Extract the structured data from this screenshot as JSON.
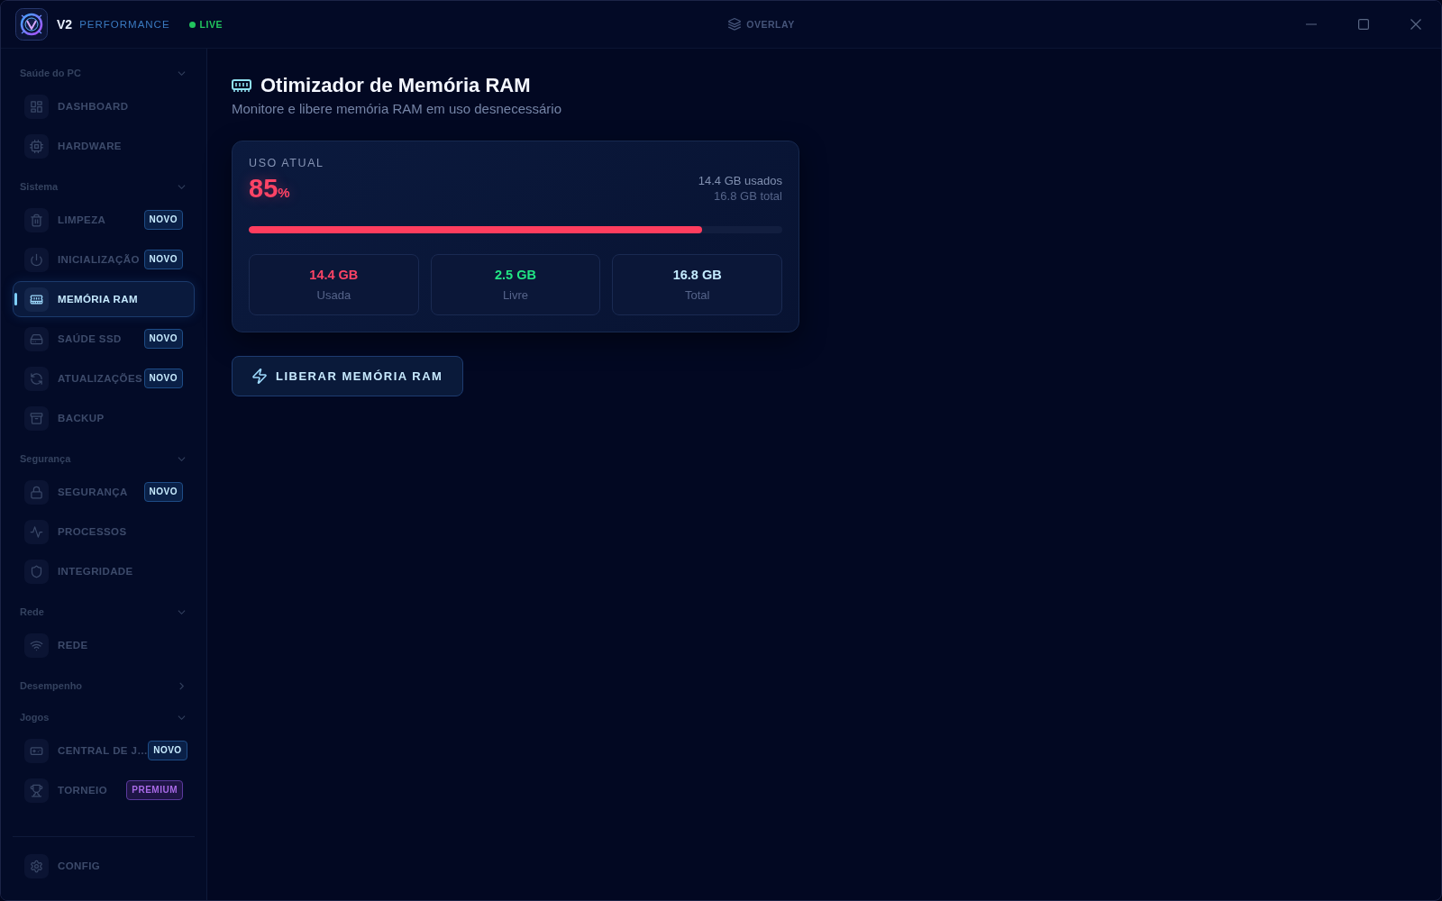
{
  "titlebar": {
    "app_name": "V2",
    "app_tagline": "PERFORMANCE",
    "live_label": "LIVE",
    "overlay_label": "OVERLAY"
  },
  "sidebar": {
    "sections": [
      {
        "title": "Saúde do PC",
        "expanded": true,
        "items": [
          {
            "label": "DASHBOARD",
            "selected": false
          },
          {
            "label": "HARDWARE",
            "selected": false
          }
        ]
      },
      {
        "title": "Sistema",
        "expanded": true,
        "items": [
          {
            "label": "LIMPEZA",
            "selected": false,
            "badge": {
              "label": "NOVO",
              "kind": "new"
            }
          },
          {
            "label": "INICIALIZAÇÃO",
            "selected": false,
            "badge": {
              "label": "NOVO",
              "kind": "new"
            }
          },
          {
            "label": "MEMÓRIA RAM",
            "selected": true
          },
          {
            "label": "SAÚDE SSD",
            "selected": false,
            "badge": {
              "label": "NOVO",
              "kind": "new"
            }
          },
          {
            "label": "ATUALIZAÇÕES",
            "selected": false,
            "badge": {
              "label": "NOVO",
              "kind": "new"
            }
          },
          {
            "label": "BACKUP",
            "selected": false
          }
        ]
      },
      {
        "title": "Segurança",
        "expanded": true,
        "items": [
          {
            "label": "SEGURANÇA",
            "selected": false,
            "badge": {
              "label": "NOVO",
              "kind": "new"
            }
          },
          {
            "label": "PROCESSOS",
            "selected": false
          },
          {
            "label": "INTEGRIDADE",
            "selected": false
          }
        ]
      },
      {
        "title": "Rede",
        "expanded": true,
        "items": [
          {
            "label": "REDE",
            "selected": false
          }
        ]
      },
      {
        "title": "Desempenho",
        "expanded": false
      },
      {
        "title": "Jogos",
        "expanded": true,
        "items": [
          {
            "label": "CENTRAL DE J…",
            "selected": false,
            "badge": {
              "label": "NOVO",
              "kind": "new"
            }
          },
          {
            "label": "TORNEIO",
            "selected": false,
            "badge": {
              "label": "PREMIUM",
              "kind": "premium"
            }
          }
        ]
      }
    ],
    "footer_item": {
      "label": "CONFIG",
      "selected": false
    }
  },
  "page": {
    "title": "Otimizador de Memória RAM",
    "subtitle": "Monitore e libere memória RAM em uso desnecessário"
  },
  "usage_card": {
    "label": "USO ATUAL",
    "percent": "85",
    "unit": "%",
    "used": "14.4 GB usados",
    "total": "16.8 GB total",
    "level": 0.85,
    "stats": [
      {
        "value": "14.4 GB",
        "label": "Usada",
        "color": "#ff4466"
      },
      {
        "value": "2.5 GB",
        "label": "Livre",
        "color": "#22e584"
      },
      {
        "value": "16.8 GB",
        "label": "Total",
        "color": "#c4ecff"
      }
    ]
  },
  "action_button": {
    "label": "LIBERAR MEMÓRIA RAM"
  }
}
